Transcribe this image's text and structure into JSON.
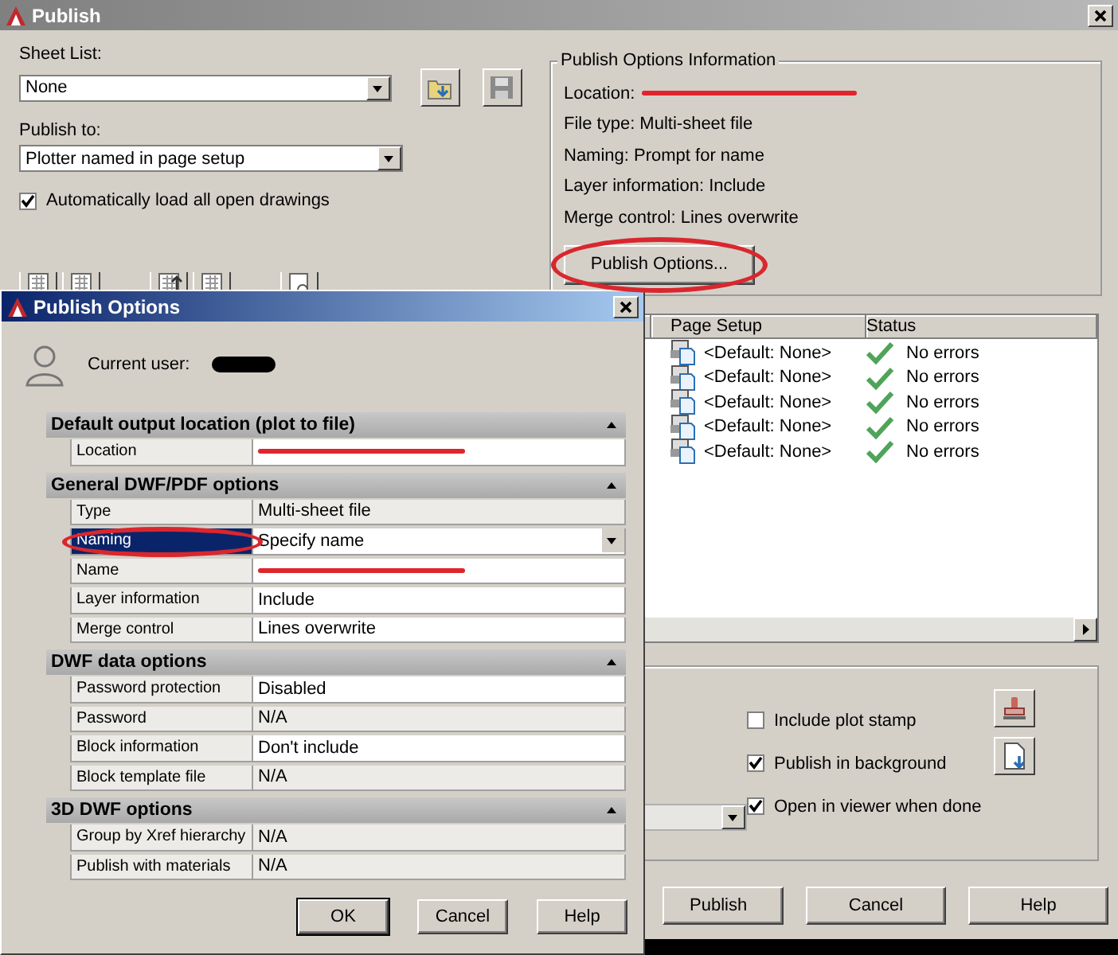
{
  "publish_window": {
    "title": "Publish",
    "sheet_list": {
      "label": "Sheet List:",
      "value": "None"
    },
    "publish_to": {
      "label": "Publish to:",
      "value": "Plotter named in page setup"
    },
    "auto_load": {
      "label": "Automatically load all open drawings",
      "checked": true
    },
    "info": {
      "title": "Publish Options Information",
      "location_label": "Location:",
      "location_redacted": true,
      "lines": [
        "File type: Multi-sheet file",
        "Naming: Prompt for name",
        "Layer information: Include",
        "Merge control: Lines overwrite"
      ]
    },
    "publish_options_button": "Publish Options...",
    "sheet_table": {
      "columns": [
        "Page Setup",
        "Status"
      ],
      "rows": [
        {
          "page_setup": "<Default: None>",
          "status": "No errors"
        },
        {
          "page_setup": "<Default: None>",
          "status": "No errors"
        },
        {
          "page_setup": "<Default: None>",
          "status": "No errors"
        },
        {
          "page_setup": "<Default: None>",
          "status": "No errors"
        },
        {
          "page_setup": "<Default: None>",
          "status": "No errors"
        }
      ]
    },
    "options": [
      {
        "label": "Include plot stamp",
        "checked": false
      },
      {
        "label": "Publish in background",
        "checked": true
      },
      {
        "label": "Open in viewer when done",
        "checked": true
      }
    ],
    "buttons": [
      "Publish",
      "Cancel",
      "Help"
    ]
  },
  "options_dialog": {
    "title": "Publish Options",
    "current_user_label": "Current user:",
    "sections": [
      {
        "title": "Default output location (plot to file)",
        "expanded": true,
        "rows": [
          {
            "name": "Location",
            "kind": "text",
            "editable": true,
            "redacted": true,
            "selected": false
          }
        ]
      },
      {
        "title": "General DWF/PDF options",
        "expanded": true,
        "rows": [
          {
            "name": "Type",
            "value": "Multi-sheet file",
            "kind": "text",
            "editable": false,
            "redacted": false,
            "selected": false
          },
          {
            "name": "Naming",
            "value": "Specify name",
            "kind": "dropdown",
            "editable": true,
            "redacted": false,
            "selected": true
          },
          {
            "name": "Name",
            "kind": "text",
            "editable": true,
            "redacted": true,
            "selected": false
          },
          {
            "name": "Layer information",
            "value": "Include",
            "kind": "text",
            "editable": true,
            "redacted": false,
            "selected": false
          },
          {
            "name": "Merge control",
            "value": "Lines overwrite",
            "kind": "text",
            "editable": true,
            "redacted": false,
            "selected": false
          }
        ]
      },
      {
        "title": "DWF data options",
        "expanded": true,
        "rows": [
          {
            "name": "Password protection",
            "value": "Disabled",
            "kind": "text",
            "editable": true,
            "redacted": false,
            "selected": false
          },
          {
            "name": "Password",
            "value": "N/A",
            "kind": "text",
            "editable": false,
            "redacted": false,
            "selected": false
          },
          {
            "name": "Block information",
            "value": "Don't include",
            "kind": "text",
            "editable": true,
            "redacted": false,
            "selected": false
          },
          {
            "name": "Block template file",
            "value": "N/A",
            "kind": "text",
            "editable": false,
            "redacted": false,
            "selected": false
          }
        ]
      },
      {
        "title": "3D DWF options",
        "expanded": true,
        "rows": [
          {
            "name": "Group by Xref hierarchy",
            "value": "N/A",
            "kind": "text",
            "editable": false,
            "redacted": false,
            "selected": false
          },
          {
            "name": "Publish with materials",
            "value": "N/A",
            "kind": "text",
            "editable": false,
            "redacted": false,
            "selected": false
          }
        ]
      }
    ],
    "buttons": [
      "OK",
      "Cancel",
      "Help"
    ]
  }
}
